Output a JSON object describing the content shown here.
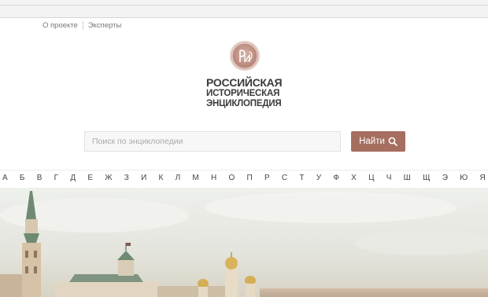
{
  "topnav": {
    "about_label": "О проекте",
    "experts_label": "Эксперты"
  },
  "logo": {
    "emblem_text": "РИЭ",
    "line1": "РОССИЙСКАЯ",
    "line2": "ИСТОРИЧЕСКАЯ",
    "line3": "ЭНЦИКЛОПЕДИЯ"
  },
  "search": {
    "placeholder": "Поиск по энциклопедии",
    "button_label": "Найти"
  },
  "alphabet": [
    "А",
    "Б",
    "В",
    "Г",
    "Д",
    "Е",
    "Ж",
    "З",
    "И",
    "К",
    "Л",
    "М",
    "Н",
    "О",
    "П",
    "Р",
    "С",
    "Т",
    "У",
    "Ф",
    "Х",
    "Ц",
    "Ч",
    "Ш",
    "Щ",
    "Э",
    "Ю",
    "Я"
  ],
  "colors": {
    "accent": "#a56e5f",
    "emblem": "#b8877a"
  },
  "icons": [
    "search-icon"
  ]
}
